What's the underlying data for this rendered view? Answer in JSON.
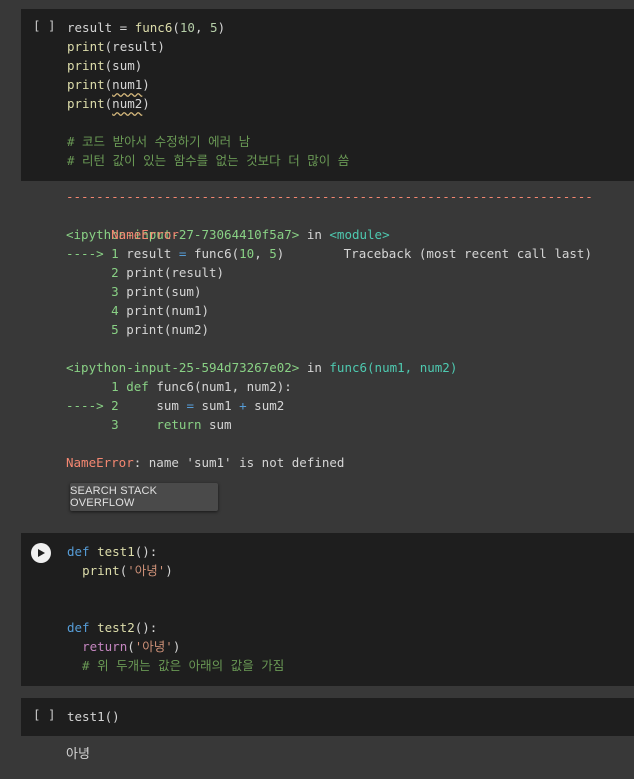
{
  "cell1": {
    "bracket": "[ ]",
    "lines": [
      "result = func6(10, 5)",
      "print(result)",
      "print(sum)",
      "print(num1)",
      "print(num2)",
      "",
      "# 코드 받아서 수정하기 에러 남",
      "# 리턴 값이 있는 함수를 없는 것보다 더 많이 씀"
    ]
  },
  "output1": {
    "dashes": "---------------------------------------------------------------------------",
    "error_name": "NameError",
    "traceback_label": "Traceback (most recent call last)",
    "frame1_file": "<ipython-input-27-73064410f5a7>",
    "frame1_in": " in ",
    "frame1_module": "<module>",
    "frame1_lines": [
      {
        "prefix": "----> 1",
        "code": "result = func6(10, 5)"
      },
      {
        "prefix": "      2",
        "code": "print(result)"
      },
      {
        "prefix": "      3",
        "code": "print(sum)"
      },
      {
        "prefix": "      4",
        "code": "print(num1)"
      },
      {
        "prefix": "      5",
        "code": "print(num2)"
      }
    ],
    "frame2_file": "<ipython-input-25-594d73267e02>",
    "frame2_in": " in ",
    "frame2_func": "func6(num1, num2)",
    "frame2_lines": [
      {
        "prefix": "      1",
        "code": "def func6(num1, num2):"
      },
      {
        "prefix": "----> 2",
        "code": "    sum = sum1 + sum2"
      },
      {
        "prefix": "      3",
        "code": "    return sum"
      }
    ],
    "final_error_name": "NameError",
    "final_error_msg": ": name 'sum1' is not defined",
    "stack_button": "SEARCH STACK OVERFLOW"
  },
  "cell2": {
    "lines": [
      "def test1():",
      "  print('아녕')",
      "",
      "",
      "def test2():",
      "  return('아녕')",
      "  # 위 두개는 값은 아래의 값을 가짐"
    ]
  },
  "cell3": {
    "bracket": "[ ]",
    "code": "test1()",
    "output": "아녕"
  }
}
